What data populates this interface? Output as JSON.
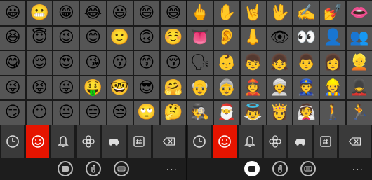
{
  "left_panel": {
    "emojis": [
      "😀",
      "😬",
      "😁",
      "😂",
      "😃",
      "😄",
      "😅",
      "😆",
      "😇",
      "😉",
      "😊",
      "🙂",
      "🙃",
      "☺️",
      "😋",
      "😌",
      "😍",
      "😘",
      "😗",
      "😙",
      "😚",
      "😜",
      "😝",
      "😛",
      "🤑",
      "🤓",
      "😎",
      "🤗",
      "😏",
      "😶",
      "😐",
      "😑",
      "😒",
      "🙄",
      "🤔"
    ],
    "active_tab": "smiley",
    "dots_label": "..."
  },
  "right_panel": {
    "emojis": [
      "🖕",
      "✋",
      "🤘",
      "🖖",
      "✍️",
      "💅",
      "👄",
      "👅",
      "👂",
      "👃",
      "👁",
      "👀",
      "👤",
      "👥",
      "🗣",
      "👶",
      "👦",
      "👧",
      "👨",
      "👩",
      "👱",
      "👴",
      "👵",
      "👲",
      "👳",
      "👮",
      "👷",
      "💂",
      "🕵",
      "🎅",
      "👼",
      "👸",
      "👰",
      "🚶",
      "🏃"
    ],
    "active_tab": "smiley",
    "dots_label": "..."
  },
  "tabs": [
    {
      "name": "recent",
      "icon": "clock-icon"
    },
    {
      "name": "smiley",
      "icon": "smiley-icon"
    },
    {
      "name": "bell",
      "icon": "bell-icon"
    },
    {
      "name": "flower",
      "icon": "flower-icon"
    },
    {
      "name": "car",
      "icon": "car-icon"
    },
    {
      "name": "symbols",
      "icon": "hash-icon"
    },
    {
      "name": "backspace",
      "icon": "backspace-icon"
    }
  ],
  "colors": {
    "accent": "#e51400",
    "cell": "#555555",
    "tab": "#3a3a3a"
  }
}
